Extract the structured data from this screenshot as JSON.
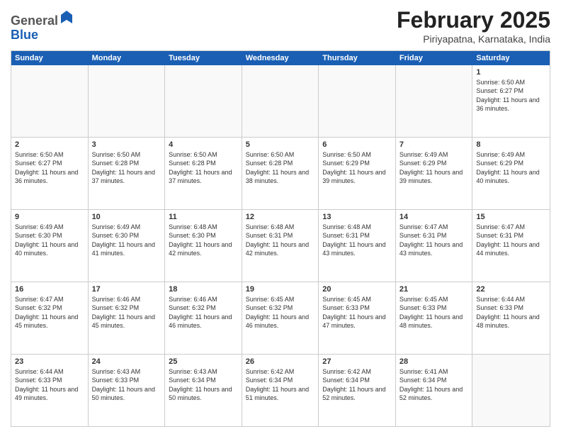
{
  "logo": {
    "general": "General",
    "blue": "Blue"
  },
  "header": {
    "month": "February 2025",
    "location": "Piriyapatna, Karnataka, India"
  },
  "days": [
    "Sunday",
    "Monday",
    "Tuesday",
    "Wednesday",
    "Thursday",
    "Friday",
    "Saturday"
  ],
  "weeks": [
    [
      {
        "day": "",
        "info": ""
      },
      {
        "day": "",
        "info": ""
      },
      {
        "day": "",
        "info": ""
      },
      {
        "day": "",
        "info": ""
      },
      {
        "day": "",
        "info": ""
      },
      {
        "day": "",
        "info": ""
      },
      {
        "day": "1",
        "info": "Sunrise: 6:50 AM\nSunset: 6:27 PM\nDaylight: 11 hours and 36 minutes."
      }
    ],
    [
      {
        "day": "2",
        "info": "Sunrise: 6:50 AM\nSunset: 6:27 PM\nDaylight: 11 hours and 36 minutes."
      },
      {
        "day": "3",
        "info": "Sunrise: 6:50 AM\nSunset: 6:28 PM\nDaylight: 11 hours and 37 minutes."
      },
      {
        "day": "4",
        "info": "Sunrise: 6:50 AM\nSunset: 6:28 PM\nDaylight: 11 hours and 37 minutes."
      },
      {
        "day": "5",
        "info": "Sunrise: 6:50 AM\nSunset: 6:28 PM\nDaylight: 11 hours and 38 minutes."
      },
      {
        "day": "6",
        "info": "Sunrise: 6:50 AM\nSunset: 6:29 PM\nDaylight: 11 hours and 39 minutes."
      },
      {
        "day": "7",
        "info": "Sunrise: 6:49 AM\nSunset: 6:29 PM\nDaylight: 11 hours and 39 minutes."
      },
      {
        "day": "8",
        "info": "Sunrise: 6:49 AM\nSunset: 6:29 PM\nDaylight: 11 hours and 40 minutes."
      }
    ],
    [
      {
        "day": "9",
        "info": "Sunrise: 6:49 AM\nSunset: 6:30 PM\nDaylight: 11 hours and 40 minutes."
      },
      {
        "day": "10",
        "info": "Sunrise: 6:49 AM\nSunset: 6:30 PM\nDaylight: 11 hours and 41 minutes."
      },
      {
        "day": "11",
        "info": "Sunrise: 6:48 AM\nSunset: 6:30 PM\nDaylight: 11 hours and 42 minutes."
      },
      {
        "day": "12",
        "info": "Sunrise: 6:48 AM\nSunset: 6:31 PM\nDaylight: 11 hours and 42 minutes."
      },
      {
        "day": "13",
        "info": "Sunrise: 6:48 AM\nSunset: 6:31 PM\nDaylight: 11 hours and 43 minutes."
      },
      {
        "day": "14",
        "info": "Sunrise: 6:47 AM\nSunset: 6:31 PM\nDaylight: 11 hours and 43 minutes."
      },
      {
        "day": "15",
        "info": "Sunrise: 6:47 AM\nSunset: 6:31 PM\nDaylight: 11 hours and 44 minutes."
      }
    ],
    [
      {
        "day": "16",
        "info": "Sunrise: 6:47 AM\nSunset: 6:32 PM\nDaylight: 11 hours and 45 minutes."
      },
      {
        "day": "17",
        "info": "Sunrise: 6:46 AM\nSunset: 6:32 PM\nDaylight: 11 hours and 45 minutes."
      },
      {
        "day": "18",
        "info": "Sunrise: 6:46 AM\nSunset: 6:32 PM\nDaylight: 11 hours and 46 minutes."
      },
      {
        "day": "19",
        "info": "Sunrise: 6:45 AM\nSunset: 6:32 PM\nDaylight: 11 hours and 46 minutes."
      },
      {
        "day": "20",
        "info": "Sunrise: 6:45 AM\nSunset: 6:33 PM\nDaylight: 11 hours and 47 minutes."
      },
      {
        "day": "21",
        "info": "Sunrise: 6:45 AM\nSunset: 6:33 PM\nDaylight: 11 hours and 48 minutes."
      },
      {
        "day": "22",
        "info": "Sunrise: 6:44 AM\nSunset: 6:33 PM\nDaylight: 11 hours and 48 minutes."
      }
    ],
    [
      {
        "day": "23",
        "info": "Sunrise: 6:44 AM\nSunset: 6:33 PM\nDaylight: 11 hours and 49 minutes."
      },
      {
        "day": "24",
        "info": "Sunrise: 6:43 AM\nSunset: 6:33 PM\nDaylight: 11 hours and 50 minutes."
      },
      {
        "day": "25",
        "info": "Sunrise: 6:43 AM\nSunset: 6:34 PM\nDaylight: 11 hours and 50 minutes."
      },
      {
        "day": "26",
        "info": "Sunrise: 6:42 AM\nSunset: 6:34 PM\nDaylight: 11 hours and 51 minutes."
      },
      {
        "day": "27",
        "info": "Sunrise: 6:42 AM\nSunset: 6:34 PM\nDaylight: 11 hours and 52 minutes."
      },
      {
        "day": "28",
        "info": "Sunrise: 6:41 AM\nSunset: 6:34 PM\nDaylight: 11 hours and 52 minutes."
      },
      {
        "day": "",
        "info": ""
      }
    ]
  ]
}
